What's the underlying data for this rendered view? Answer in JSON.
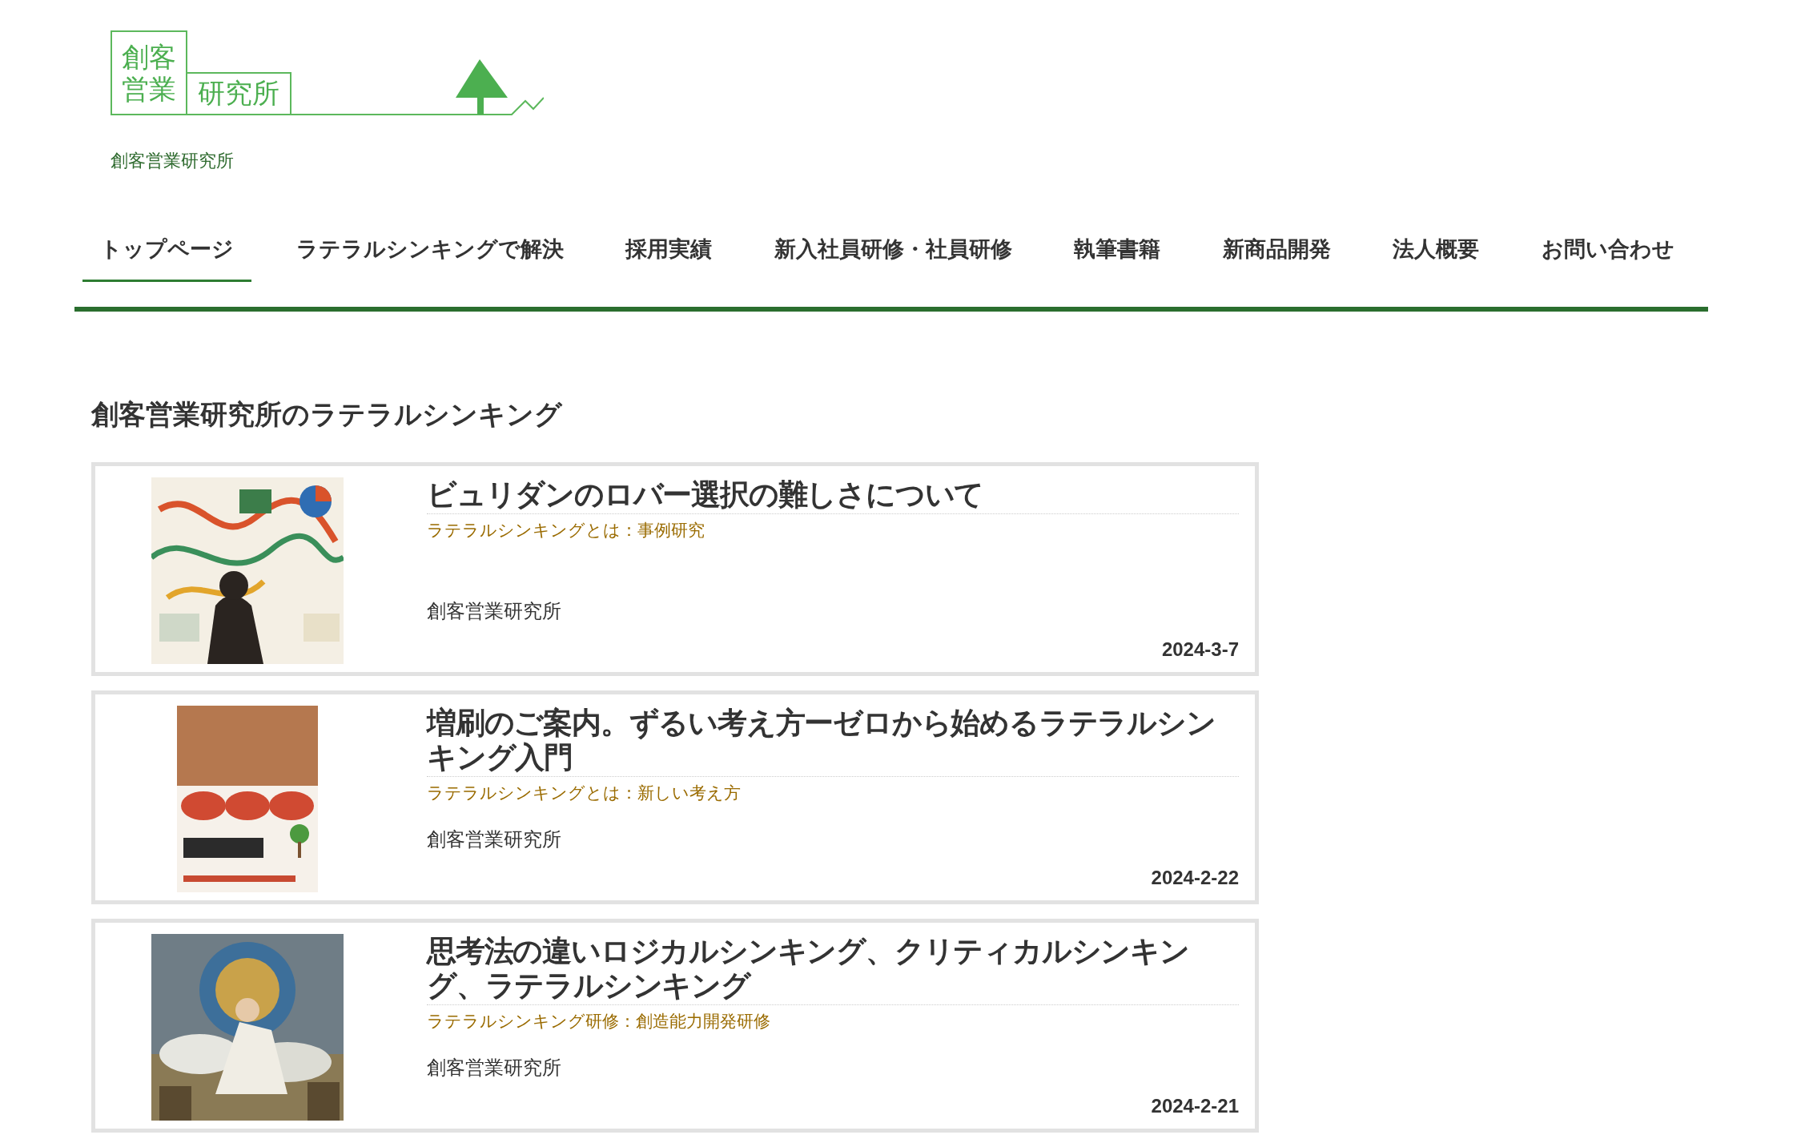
{
  "logo": {
    "lines": [
      "創客",
      "営業"
    ],
    "suffix": "研究所"
  },
  "site_name": "創客営業研究所",
  "nav": [
    {
      "label": "トップページ",
      "selected": true
    },
    {
      "label": "ラテラルシンキングで解決",
      "selected": false
    },
    {
      "label": "採用実績",
      "selected": false
    },
    {
      "label": "新入社員研修・社員研修",
      "selected": false
    },
    {
      "label": "執筆書籍",
      "selected": false
    },
    {
      "label": "新商品開発",
      "selected": false
    },
    {
      "label": "法人概要",
      "selected": false
    },
    {
      "label": "お問い合わせ",
      "selected": false
    }
  ],
  "section_title": "創客営業研究所のラテラルシンキング",
  "posts": [
    {
      "title": "ビュリダンのロバー選択の難しさについて",
      "category": "ラテラルシンキングとは：事例研究",
      "author": "創客営業研究所",
      "date": "2024-3-7"
    },
    {
      "title": "増刷のご案内。ずるい考え方ーゼロから始めるラテラルシンキング入門",
      "category": "ラテラルシンキングとは：新しい考え方",
      "author": "創客営業研究所",
      "date": "2024-2-22"
    },
    {
      "title": "思考法の違いロジカルシンキング、クリティカルシンキング、ラテラルシンキング",
      "category": "ラテラルシンキング研修：創造能力開発研修",
      "author": "創客営業研究所",
      "date": "2024-2-21"
    }
  ]
}
